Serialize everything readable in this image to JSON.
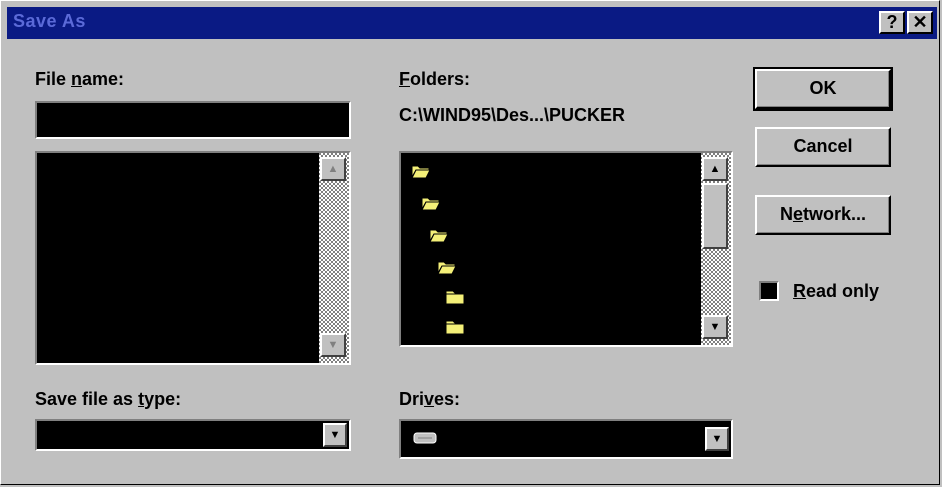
{
  "window": {
    "title": "Save As",
    "help_glyph": "?",
    "close_glyph": "✕"
  },
  "file_name": {
    "label_pre": "File ",
    "label_accel": "n",
    "label_post": "ame:",
    "value": ""
  },
  "folders": {
    "label_accel": "F",
    "label_post": "olders:",
    "path": "C:\\WIND95\\Des...\\PUCKER",
    "items": [
      {
        "icon": "open-folder-icon"
      },
      {
        "icon": "open-folder-icon"
      },
      {
        "icon": "open-folder-icon"
      },
      {
        "icon": "open-folder-icon"
      },
      {
        "icon": "closed-folder-icon"
      },
      {
        "icon": "closed-folder-icon"
      }
    ]
  },
  "save_type": {
    "label_pre": "Save file as ",
    "label_accel": "t",
    "label_post": "ype:",
    "value": ""
  },
  "drives": {
    "label_pre": "Dri",
    "label_accel": "v",
    "label_post": "es:",
    "icon": "drive-icon",
    "value": ""
  },
  "buttons": {
    "ok": "OK",
    "cancel": "Cancel",
    "network_pre": "N",
    "network_accel": "e",
    "network_post": "twork..."
  },
  "read_only": {
    "accel": "R",
    "post": "ead only",
    "checked": false
  },
  "colors": {
    "titlebar": "#0a1a84",
    "face": "#c0c0c0",
    "folder": "#f4f078"
  }
}
